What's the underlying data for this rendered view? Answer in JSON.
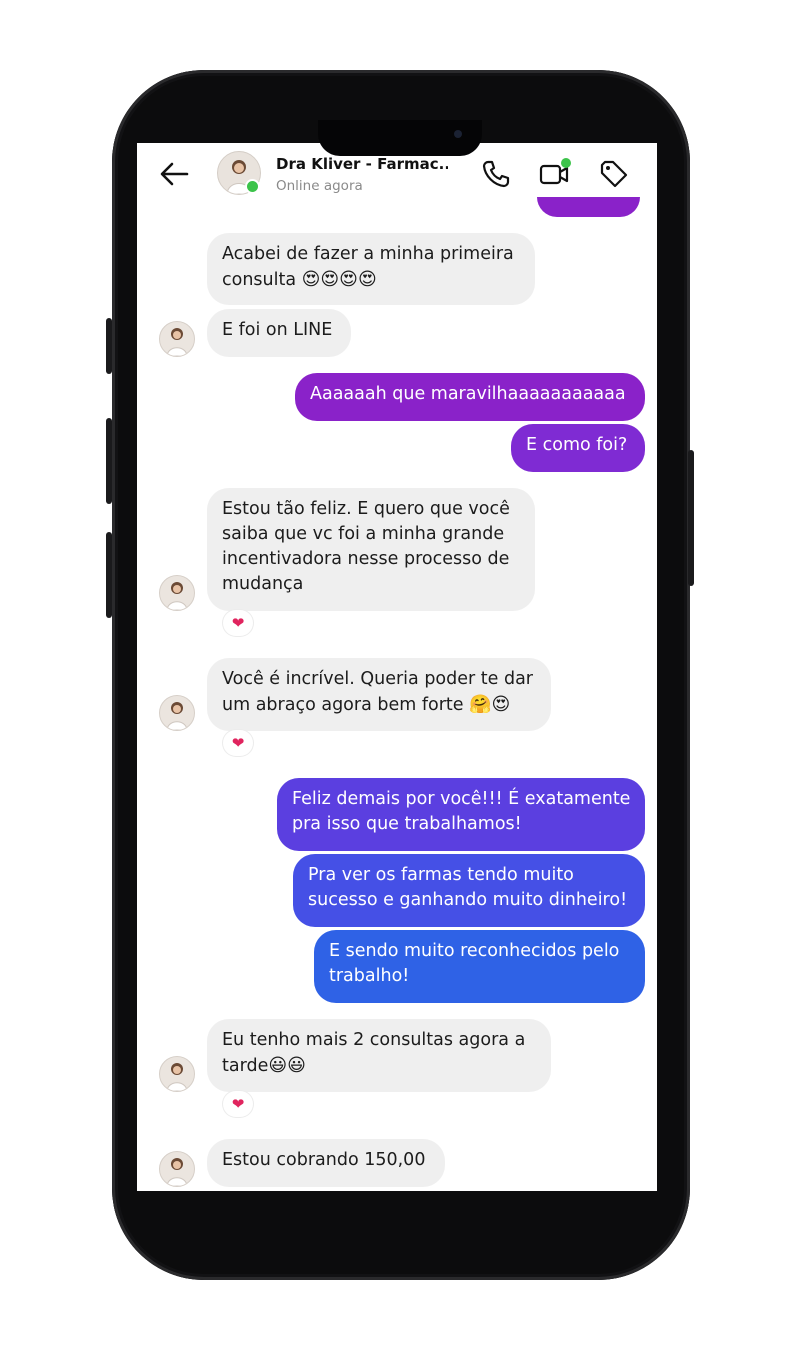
{
  "header": {
    "contact_name": "Dra Kliver - Farmac...",
    "status": "Online agora",
    "icons": [
      "back-arrow-icon",
      "phone-icon",
      "video-call-icon",
      "tag-icon"
    ]
  },
  "messages": [
    {
      "dir": "in",
      "text": "Acabei de fazer a minha primeira",
      "text2": "consulta",
      "emoji": "😍😍😍😍"
    },
    {
      "dir": "in",
      "text": "E foi on LINE"
    },
    {
      "dir": "out",
      "text": "Aaaaaah que maravilhaaaaaaaaaaa"
    },
    {
      "dir": "out",
      "text": "E como foi?"
    },
    {
      "dir": "in",
      "lines": [
        "Estou tão feliz. E quero que você",
        "saiba que vc foi a minha grande",
        "incentivadora nesse processo de",
        "mudança"
      ],
      "reaction": "❤"
    },
    {
      "dir": "in",
      "line1": "Você é incrível. Queria poder te dar",
      "line2": "um abraço agora bem forte",
      "emoji": "🤗😍",
      "reaction": "❤"
    },
    {
      "dir": "out",
      "lines": [
        "Feliz demais por você!!! É exatamente",
        "pra isso que trabalhamos!"
      ]
    },
    {
      "dir": "out",
      "lines": [
        "Pra ver os farmas tendo muito",
        "sucesso e ganhando muito dinheiro!"
      ]
    },
    {
      "dir": "out",
      "lines": [
        "E sendo muito reconhecidos pelo",
        "trabalho!"
      ]
    },
    {
      "dir": "in",
      "line1": "Eu tenho mais 2 consultas agora a",
      "line2": "tarde",
      "emoji": "😃😃",
      "reaction": "❤"
    },
    {
      "dir": "in",
      "text": "Estou cobrando 150,00"
    }
  ],
  "colors": {
    "outgoing_purple": "#8a22c9",
    "outgoing_violet": "#5b3fe0",
    "outgoing_blue": "#2f62e6",
    "incoming_bg": "#efefef",
    "online_green": "#3cc34a"
  }
}
